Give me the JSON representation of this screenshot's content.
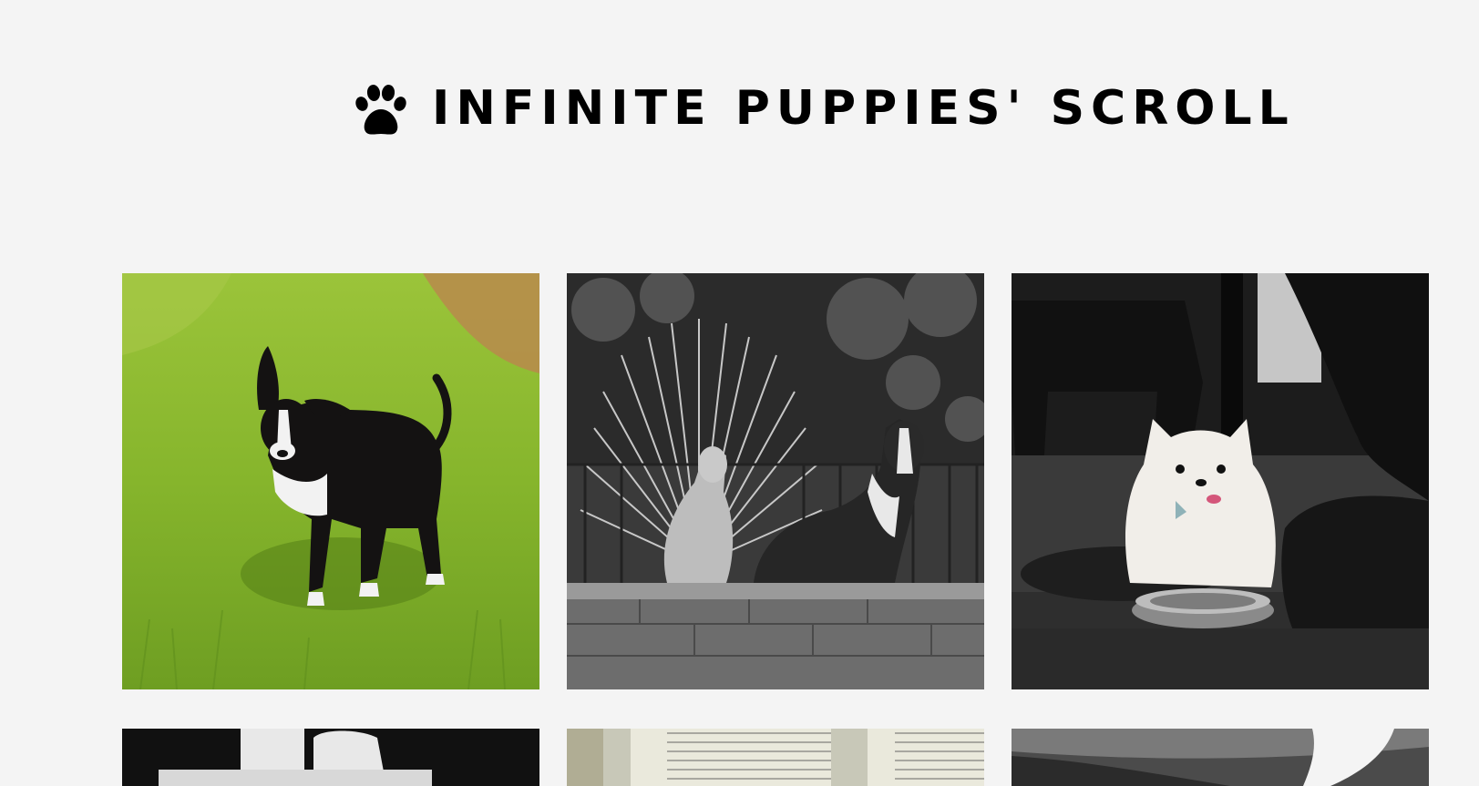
{
  "header": {
    "title": "INFINITE PUPPIES' SCROLL",
    "icon": "paw-icon"
  },
  "gallery": {
    "items": [
      {
        "name": "puppy-photo-1",
        "description_icon": "dog-photo"
      },
      {
        "name": "puppy-photo-2",
        "description_icon": "dog-photo"
      },
      {
        "name": "puppy-photo-3",
        "description_icon": "dog-photo"
      },
      {
        "name": "puppy-photo-4",
        "description_icon": "dog-photo"
      },
      {
        "name": "puppy-photo-5",
        "description_icon": "dog-photo"
      },
      {
        "name": "puppy-photo-6",
        "description_icon": "dog-photo"
      }
    ]
  },
  "colors": {
    "background": "#f4f4f4",
    "text": "#000000"
  }
}
